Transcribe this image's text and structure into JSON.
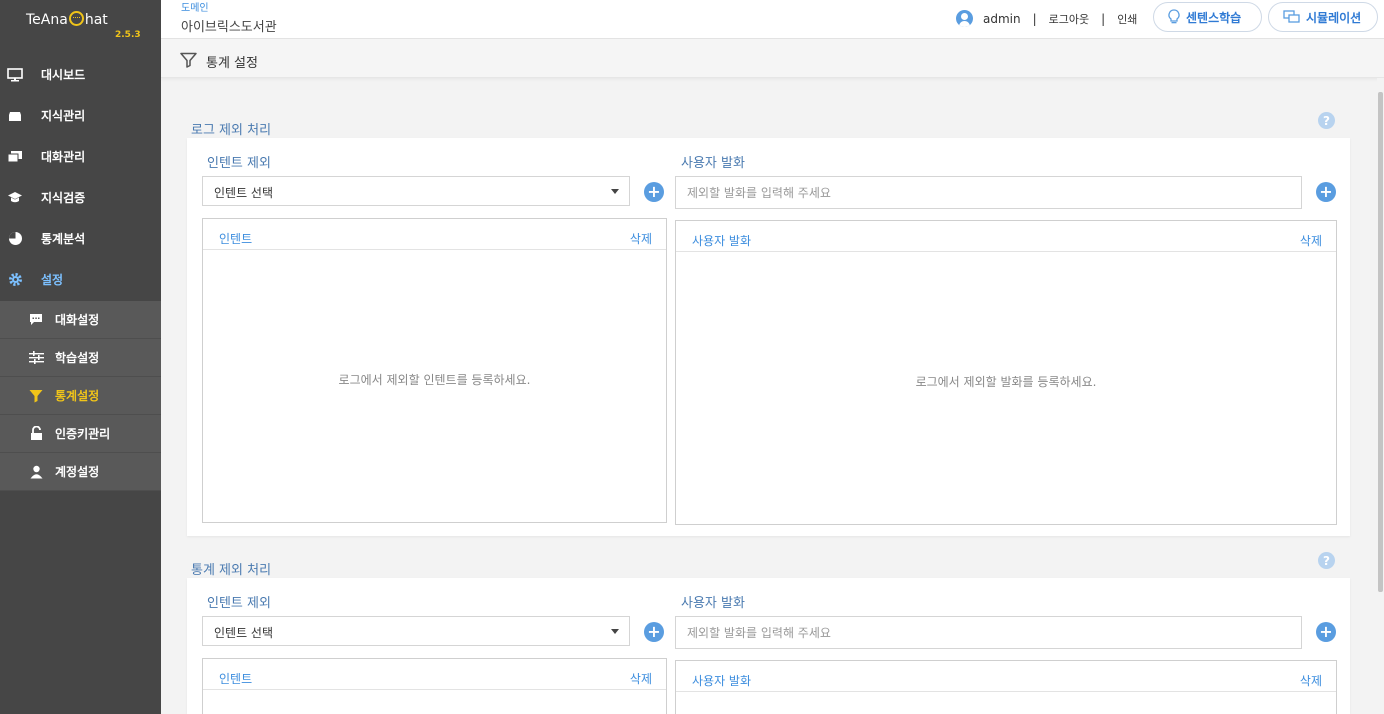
{
  "app": {
    "logo_text_left": "TeAna",
    "logo_text_right": "hat",
    "version": "2.5.3"
  },
  "sidebar": {
    "items": [
      {
        "label": "대시보드",
        "icon": "monitor-icon"
      },
      {
        "label": "지식관리",
        "icon": "box-icon"
      },
      {
        "label": "대화관리",
        "icon": "chat-icon"
      },
      {
        "label": "지식검증",
        "icon": "graduation-cap-icon"
      },
      {
        "label": "통계분석",
        "icon": "pie-chart-icon"
      },
      {
        "label": "설정",
        "icon": "gear-icon"
      }
    ],
    "subitems": [
      {
        "label": "대화설정",
        "icon": "message-icon"
      },
      {
        "label": "학습설정",
        "icon": "sliders-icon"
      },
      {
        "label": "통계설정",
        "icon": "filter-icon"
      },
      {
        "label": "인증키관리",
        "icon": "unlock-icon"
      },
      {
        "label": "계정설정",
        "icon": "user-icon"
      }
    ]
  },
  "header": {
    "domain_label": "도메인",
    "domain_name": "아이브릭스도서관",
    "username": "admin",
    "separator": "|",
    "logout": "로그아웃",
    "print": "인쇄",
    "sentence_learning": "센텐스학습",
    "simulation": "시뮬레이션"
  },
  "page": {
    "title": "통계 설정"
  },
  "log_exclusion": {
    "title": "로그 제외 처리",
    "intent_label": "인텐트 제외",
    "intent_select": "인텐트 선택",
    "utterance_label": "사용자 발화",
    "utterance_placeholder": "제외할 발화를 입력해 주세요",
    "intent_col": "인텐트",
    "utterance_col": "사용자 발화",
    "delete": "삭제",
    "intent_empty": "로그에서 제외할 인텐트를 등록하세요.",
    "utterance_empty": "로그에서 제외할 발화를 등록하세요."
  },
  "stats_exclusion": {
    "title": "통계 제외 처리",
    "intent_label": "인텐트 제외",
    "intent_select": "인텐트 선택",
    "utterance_label": "사용자 발화",
    "utterance_placeholder": "제외할 발화를 입력해 주세요",
    "intent_col": "인텐트",
    "utterance_col": "사용자 발화",
    "delete": "삭제"
  },
  "colors": {
    "sidebar_bg": "#464646",
    "submenu_bg": "#595959",
    "active_yellow": "#f0c419",
    "accent_blue": "#3c8dde"
  }
}
